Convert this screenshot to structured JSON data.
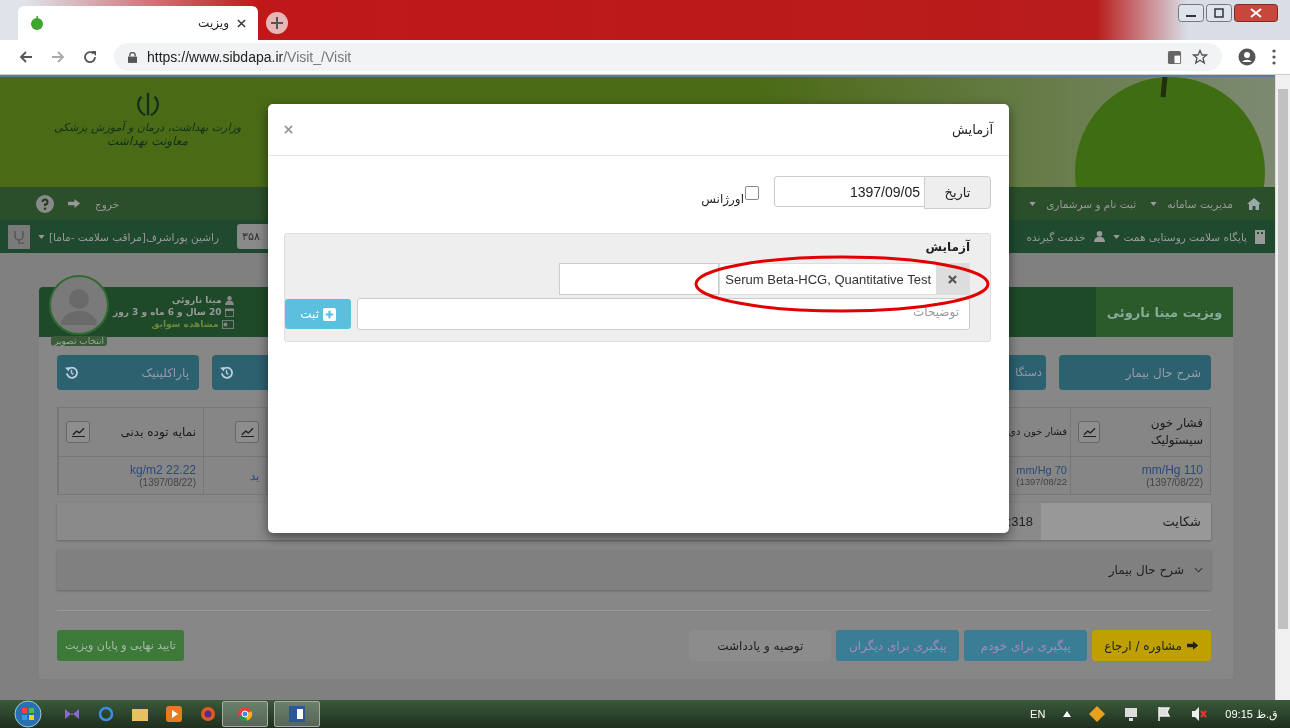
{
  "browser": {
    "tab_title": "ویزیت",
    "url_host": "https://www.sibdapa.ir",
    "url_path": "/Visit_/Visit"
  },
  "header": {
    "ministry": "وزارت بهداشت، درمان و آموزش پزشکی",
    "deputy": "معاونت بهداشت"
  },
  "nav": {
    "items": [
      "مدیریت سامانه",
      "ثبت نام و سرشماری"
    ],
    "logout": "خروج"
  },
  "subbar": {
    "facility": "پایگاه سلامت روستایی همت",
    "client": "خدمت گیرنده",
    "user": "راشین پوراشرف[مراقب سلامت -ماما]",
    "code": "۳۵۸"
  },
  "patient": {
    "name": "مینا ناروئی",
    "age": "20 سال و 6 ماه و 3 روز",
    "history_link": "مشاهده سوابق",
    "photo_label": "انتخاب تصویر",
    "visit_tab": "ویزیت مینا ناروئی"
  },
  "section_buttons_right": [
    "شرح حال بیمار",
    "دستگا"
  ],
  "section_buttons_left": [
    {
      "kind": "history"
    },
    {
      "kind": "history",
      "label": "پاراکلینیک"
    }
  ],
  "vitals": [
    {
      "label": "فشار خون سیستولیک",
      "chart_button": true,
      "value": "mm/Hg 110",
      "date": "(1397/08/22)"
    },
    {
      "label": "فشار خون دی",
      "chart_button": false,
      "value": "mm/Hg 70",
      "date": "1397/08/22)"
    },
    {
      "chart_button": true,
      "value": "ید"
    },
    {
      "label": "نمایه توده بدنی",
      "chart_button": true,
      "value": "kg/m2 22.22",
      "date": "(1397/08/22)"
    }
  ],
  "complaint": {
    "label": "شکایت",
    "value": "318:"
  },
  "history_section": {
    "title": "شرح حال بیمار",
    "expanded": false
  },
  "actions": {
    "finish": "تایید نهایی و پایان ویزیت",
    "buttons": [
      {
        "label": "مشاوره / ارجاع",
        "kind": "warning"
      },
      {
        "label": "پیگیری برای خودم",
        "kind": "info"
      },
      {
        "label": "پیگیری برای دیگران",
        "kind": "info"
      },
      {
        "label": "توصیه و یادداشت",
        "kind": "default"
      }
    ]
  },
  "modal": {
    "title": "آزمایش",
    "date_label": "تاریخ",
    "date": "1397/09/05",
    "emergency": {
      "label": "اورژانس",
      "checked": false
    },
    "panel_title": "آزمایش",
    "tests": [
      "Serum Beta-HCG, Quantitative Test"
    ],
    "notes_placeholder": "توضیحات",
    "submit": "ثبت"
  },
  "taskbar": {
    "language": "EN",
    "time": "09:15 ق.ظ"
  }
}
